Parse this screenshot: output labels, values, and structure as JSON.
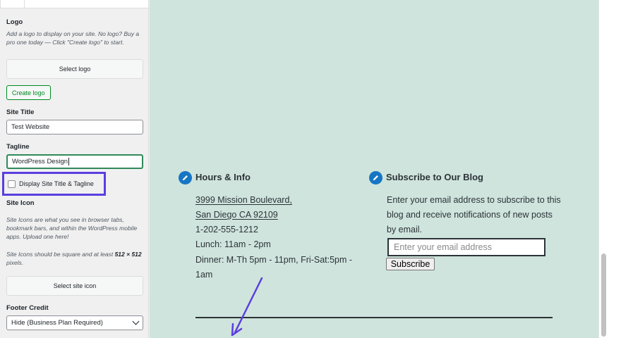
{
  "sidebar": {
    "logo_label": "Logo",
    "logo_description": "Add a logo to display on your site. No logo? Buy a pro one today — Click \"Create logo\" to start.",
    "select_logo_label": "Select logo",
    "create_logo_label": "Create logo",
    "site_title_label": "Site Title",
    "site_title_value": "Test Website",
    "tagline_label": "Tagline",
    "tagline_value": "WordPress Design",
    "display_title_checkbox_label": "Display Site Title & Tagline",
    "display_title_checked": false,
    "site_icon_label": "Site Icon",
    "site_icon_description_1": "Site Icons are what you see in browser tabs, bookmark bars, and within the WordPress mobile apps. Upload one here!",
    "site_icon_description_2_prefix": "Site Icons should be square and at least ",
    "site_icon_description_2_bold": "512 × 512",
    "site_icon_description_2_suffix": " pixels.",
    "select_site_icon_label": "Select site icon",
    "footer_credit_label": "Footer Credit",
    "footer_credit_value": "Hide (Business Plan Required)"
  },
  "preview": {
    "hours_widget": {
      "icon": "pencil-icon",
      "title": "Hours & Info",
      "address_line_1": "3999 Mission Boulevard,",
      "address_line_2": "San Diego CA 92109",
      "phone": "1-202-555-1212",
      "lunch": "Lunch: 11am - 2pm",
      "dinner_line_1": "Dinner: M-Th 5pm - 11pm, Fri-Sat:5pm -",
      "dinner_line_2": "1am"
    },
    "subscribe_widget": {
      "icon": "pencil-icon",
      "title": "Subscribe to Our Blog",
      "description": "Enter your email address to subscribe to this blog and receive notifications of new posts by email.",
      "email_placeholder": "Enter your email address",
      "button_label": "Subscribe"
    }
  },
  "colors": {
    "preview_background": "#cfe4dc",
    "highlight_box": "#5b3ee0",
    "annotation_arrow": "#5b3ee0",
    "widget_icon": "#1676c4",
    "create_logo_accent": "#008a20"
  }
}
